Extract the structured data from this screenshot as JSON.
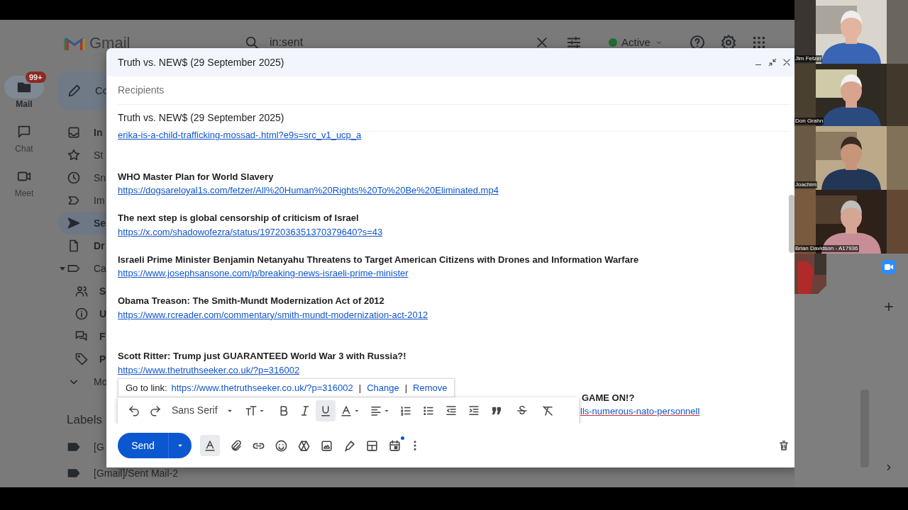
{
  "gmail": {
    "logo": "Gmail",
    "search": {
      "value": "in:sent"
    },
    "status": {
      "label": "Active",
      "color": "#1e6e34"
    },
    "rail": [
      {
        "label": "Mail",
        "badge": "99+",
        "selected": true
      },
      {
        "label": "Chat",
        "selected": false
      },
      {
        "label": "Meet",
        "selected": false
      }
    ],
    "compose_button": "Co",
    "nav": [
      {
        "label": "In",
        "unread": true,
        "selected": false
      },
      {
        "label": "St",
        "unread": false,
        "selected": false
      },
      {
        "label": "Sn",
        "unread": false,
        "selected": false
      },
      {
        "label": "Im",
        "unread": false,
        "selected": false
      },
      {
        "label": "Se",
        "unread": true,
        "selected": true
      },
      {
        "label": "Dr",
        "unread": true,
        "selected": false
      },
      {
        "label": "Ca",
        "unread": false,
        "selected": false,
        "expanded": true,
        "children": [
          {
            "label": "S",
            "unread": true,
            "selected": false
          },
          {
            "label": "U",
            "unread": true,
            "selected": false
          },
          {
            "label": "F",
            "unread": true,
            "selected": false
          },
          {
            "label": "P",
            "unread": true,
            "selected": false
          }
        ]
      },
      {
        "label": "Mo",
        "unread": false,
        "selected": false
      }
    ],
    "labels": {
      "heading": "Labels",
      "items": [
        "[G",
        "[Gmail]/Sent Mail-2"
      ]
    }
  },
  "compose": {
    "title": "Truth vs. NEW$ (29 September 2025)",
    "recipients_placeholder": "Recipients",
    "subject": "Truth vs. NEW$ (29 September 2025)",
    "body": [
      {
        "kind": "link",
        "text": "erika-is-a-child-trafficking-mossad-.html?e9s=src_v1_ucp_a"
      },
      {
        "kind": "blank"
      },
      {
        "kind": "blank"
      },
      {
        "kind": "heading",
        "text": "WHO Master Plan for World Slavery"
      },
      {
        "kind": "link",
        "text": "https://dogsareloyal1s.com/fetzer/All%20Human%20Rights%20To%20Be%20Eliminated.mp4"
      },
      {
        "kind": "blank"
      },
      {
        "kind": "heading",
        "text": "The next step is global censorship of criticism of Israel"
      },
      {
        "kind": "link",
        "text": "https://x.com/shadowofezra/status/1972036351370379640?s=43"
      },
      {
        "kind": "blank"
      },
      {
        "kind": "heading",
        "text": "Israeli Prime Minister Benjamin Netanyahu Threatens to Target American Citizens with Drones and Information Warfare"
      },
      {
        "kind": "link",
        "text": "https://www.josephsansone.com/p/breaking-news-israeli-prime-minister"
      },
      {
        "kind": "blank"
      },
      {
        "kind": "heading",
        "text": "Obama Treason: The Smith-Mundt Modernization Act of 2012"
      },
      {
        "kind": "link",
        "text": "https://www.rcreader.com/commentary/smith-mundt-modernization-act-2012"
      },
      {
        "kind": "blank"
      },
      {
        "kind": "blank"
      },
      {
        "kind": "heading",
        "text": "Scott Ritter: Trump just GUARANTEED World War 3 with Russia?!"
      },
      {
        "kind": "link",
        "text": "https://www.thetruthseeker.co.uk/?p=316002"
      },
      {
        "kind": "blank"
      },
      {
        "kind": "covered_heading",
        "text": "GAME ON!?"
      },
      {
        "kind": "covered_link",
        "text": "lls-numerous-nato-personnell"
      }
    ],
    "link_popup": {
      "label": "Go to link:",
      "url": "https://www.thetruthseeker.co.uk/?p=316002",
      "separator": "|",
      "actions": [
        "Change",
        "Remove"
      ]
    },
    "format_bar": {
      "font": "Sans Serif",
      "underline_on": true
    },
    "formatting_on": true,
    "send": "Send"
  },
  "participants": [
    {
      "name": "Jim Fetzer"
    },
    {
      "name": "Don Grahn"
    },
    {
      "name": "Joachim"
    },
    {
      "name": "Brian Davidson - A17936"
    }
  ]
}
